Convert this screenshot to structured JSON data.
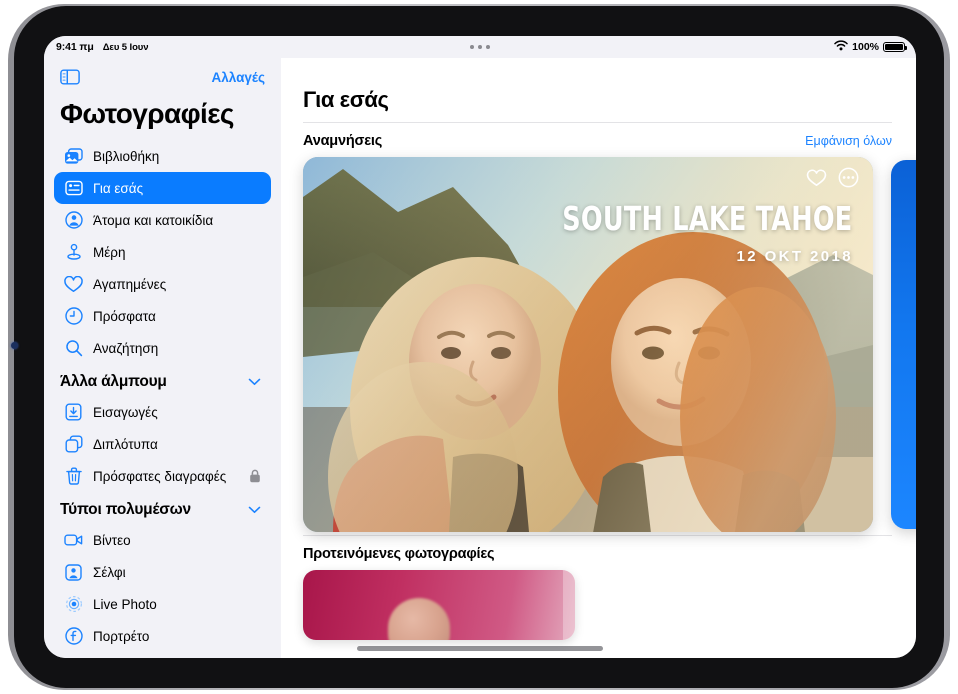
{
  "statusbar": {
    "time": "9:41 πμ",
    "date": "Δευ 5 Ιουν",
    "wifi_icon": "wifi-icon",
    "battery_percent": "100%",
    "battery_icon": "battery-full-icon",
    "multitasking_icon": "multitasking-dots-icon"
  },
  "sidebar": {
    "toggle_icon": "sidebar-toggle-icon",
    "edit_label": "Αλλαγές",
    "app_title": "Φωτογραφίες",
    "items": [
      {
        "label": "Βιβλιοθήκη",
        "icon": "photo-library-icon",
        "selected": false
      },
      {
        "label": "Για εσάς",
        "icon": "for-you-icon",
        "selected": true
      },
      {
        "label": "Άτομα και κατοικίδια",
        "icon": "people-pets-icon",
        "selected": false
      },
      {
        "label": "Μέρη",
        "icon": "places-pin-icon",
        "selected": false
      },
      {
        "label": "Αγαπημένες",
        "icon": "heart-icon",
        "selected": false
      },
      {
        "label": "Πρόσφατα",
        "icon": "clock-icon",
        "selected": false
      },
      {
        "label": "Αναζήτηση",
        "icon": "search-icon",
        "selected": false
      }
    ],
    "groups": [
      {
        "title": "Άλλα άλμπουμ",
        "chevron_icon": "chevron-down-icon",
        "items": [
          {
            "label": "Εισαγωγές",
            "icon": "import-icon",
            "badge": null
          },
          {
            "label": "Διπλότυπα",
            "icon": "duplicates-icon",
            "badge": null
          },
          {
            "label": "Πρόσφατες διαγραφές",
            "icon": "trash-icon",
            "badge": "lock-icon"
          }
        ]
      },
      {
        "title": "Τύποι πολυμέσων",
        "chevron_icon": "chevron-down-icon",
        "items": [
          {
            "label": "Βίντεο",
            "icon": "video-icon",
            "badge": null
          },
          {
            "label": "Σέλφι",
            "icon": "selfie-icon",
            "badge": null
          },
          {
            "label": "Live Photo",
            "icon": "live-photo-icon",
            "badge": null
          },
          {
            "label": "Πορτρέτο",
            "icon": "portrait-icon",
            "badge": null
          }
        ]
      }
    ]
  },
  "main": {
    "page_title": "Για εσάς",
    "sections": [
      {
        "title": "Αναμνήσεις",
        "see_all_label": "Εμφάνιση όλων"
      },
      {
        "title": "Προτεινόμενες φωτογραφίες",
        "see_all_label": ""
      }
    ],
    "memory_card": {
      "title": "SOUTH LAKE TAHOE",
      "date": "12 ΟΚΤ 2018",
      "favorite_icon": "heart-outline-icon",
      "more_icon": "more-ellipsis-icon"
    }
  },
  "colors": {
    "accent_blue": "#0a7cff",
    "link_blue": "#1c83ff",
    "sidebar_bg": "#f2f2f7",
    "content_bg": "#ffffff",
    "divider": "#e3e3e6"
  }
}
